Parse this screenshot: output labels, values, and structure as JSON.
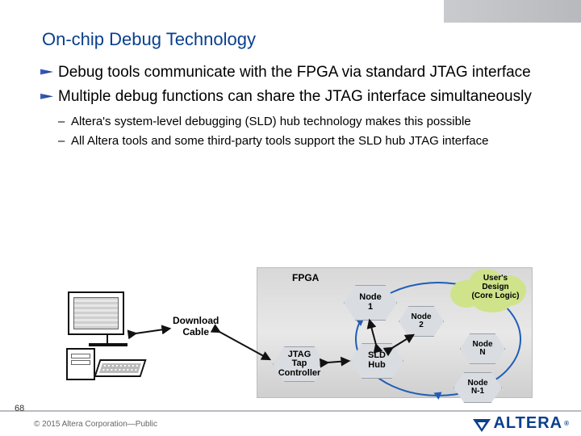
{
  "title": "On-chip Debug Technology",
  "bullets": [
    "Debug tools communicate with the FPGA via standard JTAG interface",
    "Multiple debug functions can share the JTAG interface simultaneously"
  ],
  "subbullets": [
    "Altera's system-level debugging (SLD) hub technology makes this possible",
    "All Altera tools and some third-party tools support the SLD hub JTAG interface"
  ],
  "diagram": {
    "download_cable": "Download\nCable",
    "fpga_label": "FPGA",
    "jtag": "JTAG\nTap\nController",
    "sld": "SLD\nHub",
    "node1": "Node\n1",
    "node2": "Node\n2",
    "noden": "Node\nN",
    "noden1": "Node\nN-1",
    "cloud": "User's\nDesign\n(Core Logic)"
  },
  "footer": {
    "page": "68",
    "copyright": "© 2015 Altera Corporation—Public",
    "logo_text": "ALTERA",
    "logo_reg": "®"
  }
}
